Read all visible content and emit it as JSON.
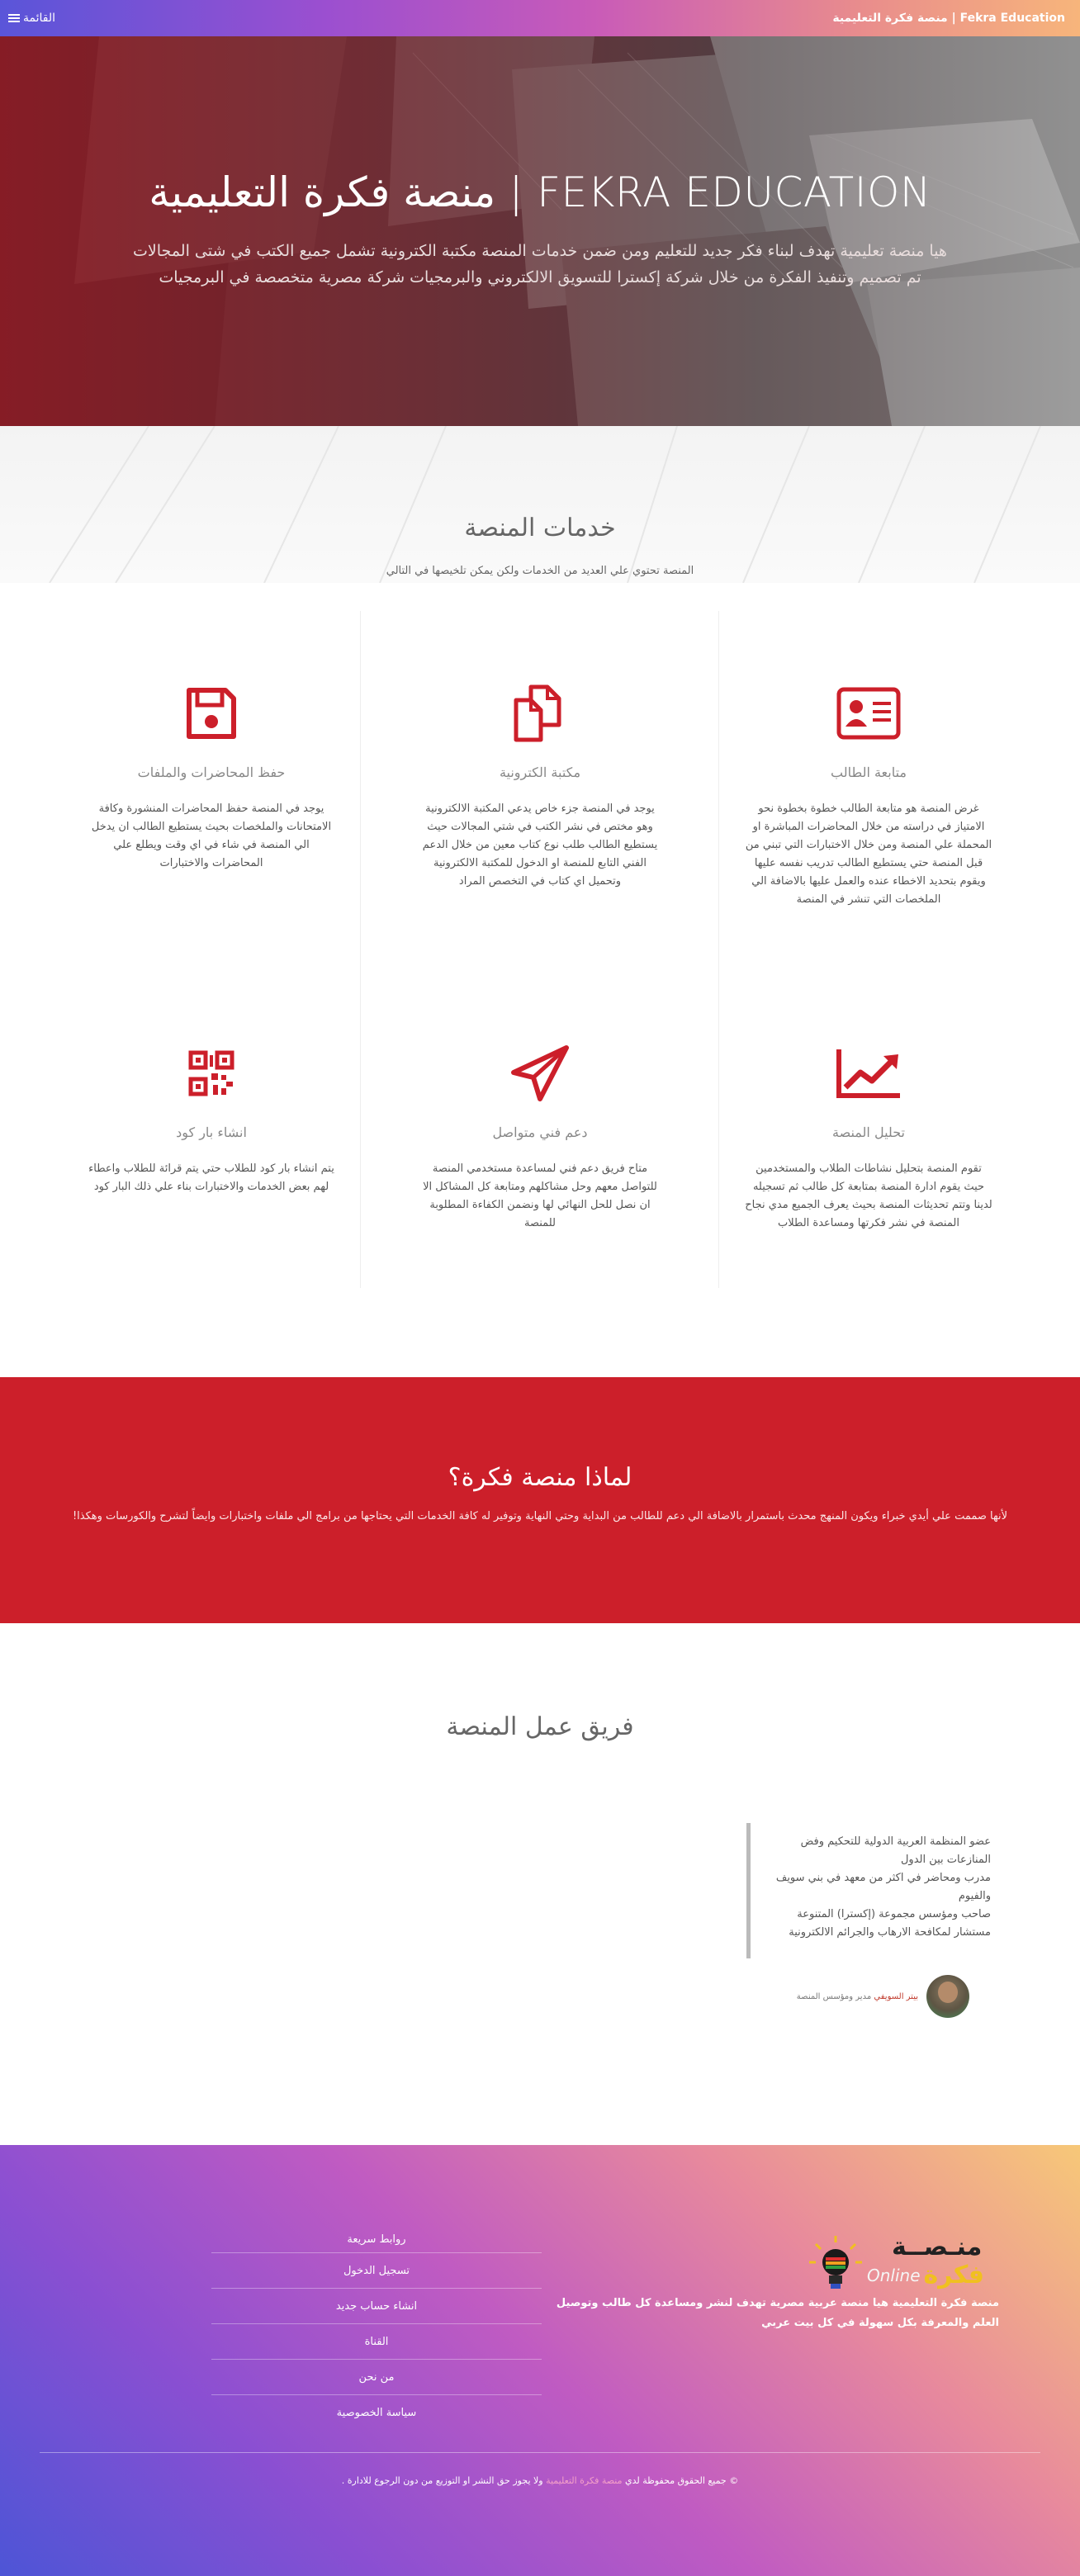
{
  "navbar": {
    "brand": "منصة فكرة التعليمية | Fekra Education",
    "menu_label": "القائمة",
    "menu_icon": "hamburger-icon"
  },
  "hero": {
    "title": "FEKRA EDUCATION | منصة فكرة التعليمية",
    "desc_line1": "هيا منصة تعليمية تهدف لبناء فكر جديد للتعليم ومن ضمن خدمات المنصة مكتبة الكترونية تشمل جميع الكتب في شتى المجالات",
    "desc_line2": "تم تصميم وتنفيذ الفكرة من خلال شركة إكسترا للتسويق الالكتروني والبرمجيات شركة مصرية متخصصة في البرمجيات"
  },
  "services": {
    "title": "خدمات المنصة",
    "subtitle": "المنصة تحتوي علي العديد من الخدمات ولكن يمكن تلخيصها في التالي",
    "items": [
      {
        "icon": "id-card-icon",
        "title": "متابعة الطالب",
        "text": "غرض المنصة هو متابعة الطالب خطوة بخطوة نحو الامتياز في دراسته من خلال المحاضرات المباشرة او المحملة علي المنصة ومن خلال الاختبارات التي تبني من قبل المنصة حتي يستطيع الطالب تدريب نفسه عليها ويقوم بتحديد الاخطاء عنده والعمل عليها بالاضافة الي الملخصات التي تنشر في المنصة"
      },
      {
        "icon": "files-icon",
        "title": "مكتبة الكترونية",
        "text": "يوجد في المنصة جزء خاص يدعي المكتبة الالكترونية وهو مختص في نشر الكتب في شتي المجالات حيث يستطيع الطالب طلب نوع كتاب معين من خلال الدعم الفني التابع للمنصة او الدخول للمكتبة الالكترونية وتحميل اي كتاب في التخصص المراد"
      },
      {
        "icon": "floppy-disk-icon",
        "title": "حفظ المحاضرات والملفات",
        "text": "يوجد في المنصة حفظ المحاضرات المنشورة وكافة الامتحانات والملخصات بحيث يستطيع الطالب ان يدخل الي المنصة في شاء في اي وقت ويطلع علي المحاضرات والاختبارات"
      },
      {
        "icon": "chart-line-icon",
        "title": "تحليل المنصة",
        "text": "تقوم المنصة بتحليل نشاطات الطلاب والمستخدمين حيث يقوم ادارة المنصة بمتابعة كل طالب ثم تسجيله لدينا وتتم تحديثات المنصة بحيث يعرف الجميع مدي نجاح المنصة في نشر فكرتها ومساعدة الطلاب"
      },
      {
        "icon": "paper-plane-icon",
        "title": "دعم فني متواصل",
        "text": "متاح فريق دعم فني لمساعدة مستخدمي المنصة للتواصل معهم وحل مشاكلهم ومتابعة كل المشاكل الا ان نصل للحل النهائي لها ونضمن الكفاءة المطلوبة للمنصة"
      },
      {
        "icon": "qr-code-icon",
        "title": "انشاء بار كود",
        "text": "يتم انشاء بار كود للطلاب حتي يتم قرائة للطلاب واعطاء لهم بعض الخدمات والاختبارات بناء علي ذلك البار كود"
      }
    ]
  },
  "why": {
    "title": "لماذا منصة فكرة؟",
    "text": "لأنها صممت علي أيدي خبراء ويكون المنهج محدث باستمرار بالاضافة الي دعم للطالب من البداية وحتي النهاية وتوفير له كافة الخدمات التي يحتاجها من برامج الي ملفات واختبارات وايضاً لتشرح والكورسات وهكذا!"
  },
  "team": {
    "title": "فريق عمل المنصة",
    "quote_lines": [
      "عضو المنظمة العربية الدولية للتحكيم وفض",
      "المنازعات بين الدول",
      "مدرب ومحاضر في اكثر من معهد في بني سويف",
      "والفيوم",
      "صاحب ومؤسس مجموعة (إكسترا) المتنوعة",
      "مستشار لمكافحة الارهاب والجرائم الالكترونية"
    ],
    "person_name": "بيتر السويفي",
    "person_role": "مدير ومؤسس المنصة"
  },
  "footer": {
    "logo_main": "منـصــة",
    "logo_online": "Online",
    "logo_fikra": "فكرة",
    "about": "منصة فكرة التعليمية هيا منصة عربية مصرية تهدف لنشر ومساعدة كل طالب وتوصيل العلم والمعرفة بكل سهولة في كل بيت عربي",
    "links_heading": "روابط سريعة",
    "links": [
      "تسجيل الدخول",
      "انشاء حساب جديد",
      "القناة",
      "من نحن",
      "سياسة الخصوصية"
    ],
    "copyright_pre": "© جميع الحقوق محفوظة لدي",
    "copyright_hl": "منصة فكرة التعليمية",
    "copyright_post": "ولا يجوز حق النشر او التوزيع من دون الرجوع للادارة ."
  },
  "colors": {
    "accent_red": "#cc1f2a",
    "icon_red": "#cc1f2a"
  }
}
